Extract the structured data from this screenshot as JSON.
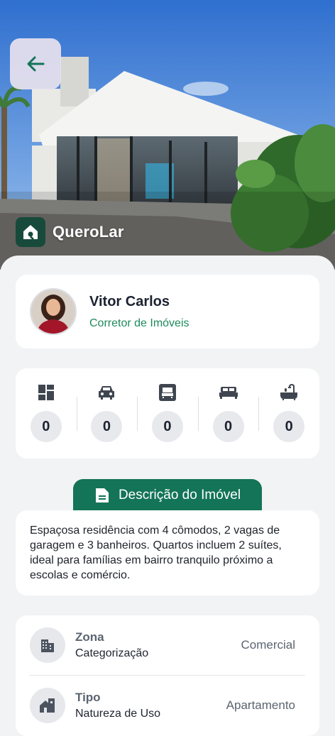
{
  "brand": {
    "name": "QueroLar"
  },
  "agent": {
    "name": "Vitor Carlos",
    "role": "Corretor de Imóveis"
  },
  "features": [
    {
      "icon": "dashboard-icon",
      "count": "0"
    },
    {
      "icon": "car-icon",
      "count": "0"
    },
    {
      "icon": "sofa-icon",
      "count": "0"
    },
    {
      "icon": "bed-icon",
      "count": "0"
    },
    {
      "icon": "bathtub-icon",
      "count": "0"
    }
  ],
  "description": {
    "tab_label": "Descrição do Imóvel",
    "text": "Espaçosa residência com 4 cômodos, 2 vagas de garagem e 3 banheiros. Quartos incluem 2 suítes, ideal para famílias em bairro tranquilo próximo a escolas e comércio."
  },
  "info": [
    {
      "icon": "buildings-icon",
      "title": "Zona",
      "subtitle": "Categorização",
      "value": "Comercial"
    },
    {
      "icon": "house-building-icon",
      "title": "Tipo",
      "subtitle": "Natureza de Uso",
      "value": "Apartamento"
    }
  ],
  "colors": {
    "accent": "#137457",
    "brand_dark": "#174a3a",
    "role_text": "#1f8a5c"
  }
}
